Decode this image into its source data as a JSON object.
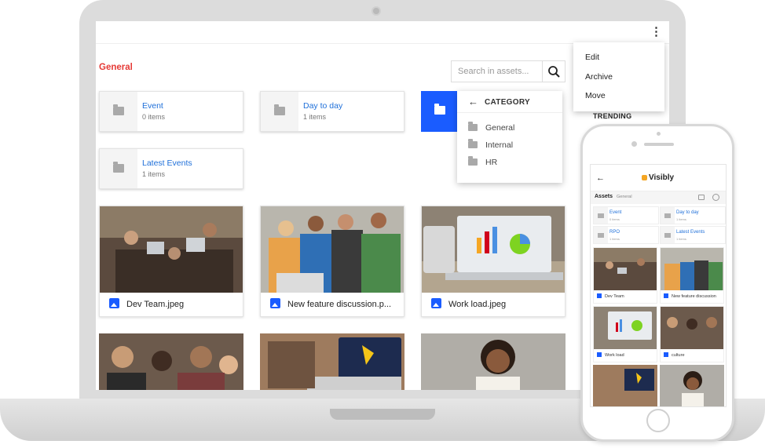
{
  "app": {
    "section_title": "General",
    "search": {
      "placeholder": "Search in assets..."
    },
    "menu_kebab": "⋮",
    "folders": [
      {
        "name": "Event",
        "count": "0 items"
      },
      {
        "name": "Day to day",
        "count": "1 items"
      },
      {
        "name": "Latest Events",
        "count": "1 items"
      }
    ],
    "category_menu": {
      "title": "CATEGORY",
      "back": "←",
      "items": [
        "General",
        "Internal",
        "HR"
      ]
    },
    "context_menu": {
      "items": [
        "Edit",
        "Archive",
        "Move"
      ]
    },
    "trending_label": "TRENDING",
    "assets": [
      {
        "name": "Dev Team.jpeg"
      },
      {
        "name": "New feature discussion.p..."
      },
      {
        "name": "Work load.jpeg"
      }
    ],
    "colors": {
      "accent": "#1a5cff",
      "title_red": "#e53935",
      "link_blue": "#1e6fd9"
    }
  },
  "phone": {
    "back": "←",
    "brand": "Visibly",
    "assets_label": "Assets",
    "assets_sub": "General",
    "folders": [
      {
        "name": "Event",
        "count": "0 items"
      },
      {
        "name": "Day to day",
        "count": "1 items"
      },
      {
        "name": "RPO",
        "count": "1 items"
      },
      {
        "name": "Latest Events",
        "count": "1 items"
      }
    ],
    "cards": [
      {
        "name": "Dev Team"
      },
      {
        "name": "New feature discussion"
      },
      {
        "name": "Work load"
      },
      {
        "name": "culture"
      }
    ]
  }
}
